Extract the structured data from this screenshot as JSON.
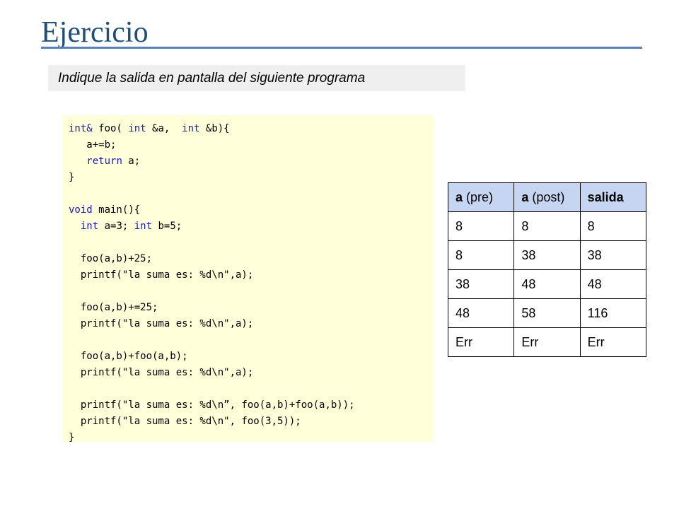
{
  "slide": {
    "title": "Ejercicio",
    "instruction": "Indique la salida en pantalla del siguiente programa"
  },
  "code": {
    "lines": [
      "int& foo( int &a,  int &b){",
      "   a+=b;",
      "   return a;",
      "}",
      "",
      "void main(){",
      "  int a=3; int b=5;",
      "",
      "  foo(a,b)+25;",
      "  printf(\"la suma es: %d\\n\",a);",
      "",
      "  foo(a,b)+=25;",
      "  printf(\"la suma es: %d\\n\",a);",
      "",
      "  foo(a,b)+foo(a,b);",
      "  printf(\"la suma es: %d\\n\",a);",
      "",
      "  printf(\"la suma es: %d\\n”, foo(a,b)+foo(a,b));",
      "  printf(\"la suma es: %d\\n\", foo(3,5));",
      "}"
    ]
  },
  "table": {
    "headers": [
      {
        "bold": "a",
        "rest": " (pre)"
      },
      {
        "bold": "a",
        "rest": " (post)"
      },
      {
        "bold": "salida",
        "rest": ""
      }
    ],
    "rows": [
      [
        "8",
        "8",
        "8"
      ],
      [
        "8",
        "38",
        "38"
      ],
      [
        "38",
        "48",
        "48"
      ],
      [
        "48",
        "58",
        "116"
      ],
      [
        "Err",
        "Err",
        "Err"
      ]
    ]
  },
  "colors": {
    "title": "#1F4E79",
    "rule": "#5B7FB8",
    "code_bg": "#FFFFD9",
    "keyword": "#1B1BB6",
    "table_header_bg": "#C6D6F2"
  }
}
